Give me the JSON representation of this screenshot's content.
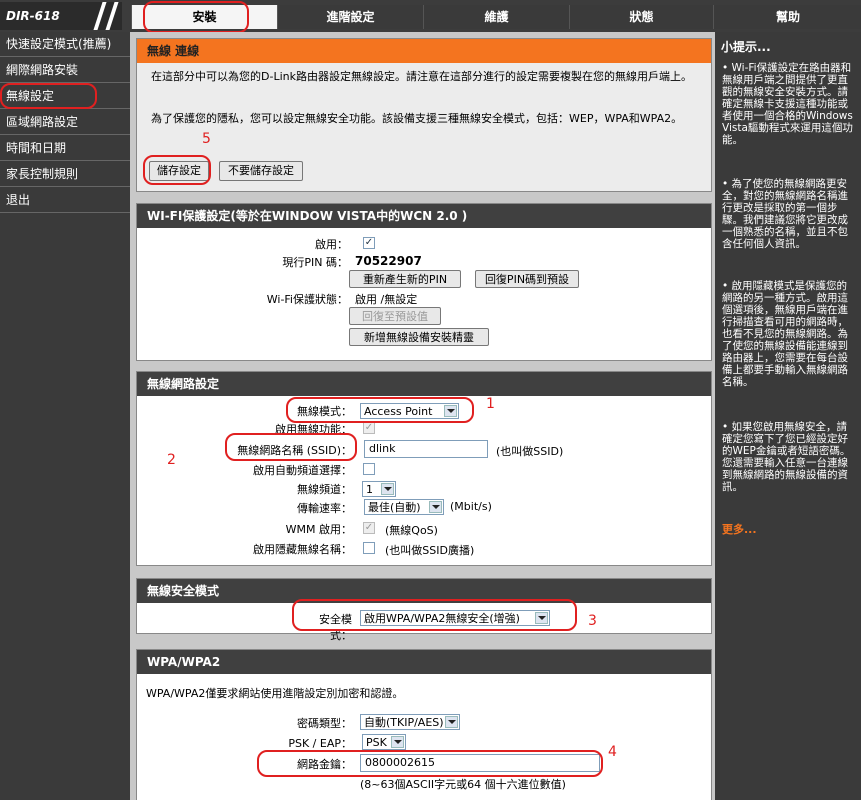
{
  "brand": {
    "model": "DIR-618"
  },
  "nav_tabs": [
    "安裝",
    "進階設定",
    "維護",
    "狀態",
    "幫助"
  ],
  "left_menu": [
    "快速設定模式(推薦)",
    "網際網路安裝",
    "無線設定",
    "區域網路設定",
    "時間和日期",
    "家長控制規則",
    "退出"
  ],
  "wireless_intro": {
    "title": "無線 連線",
    "p1": "在這部分中可以為您的D-Link路由器設定無線設定。請注意在這部分進行的設定需要複製在您的無線用戶端上。",
    "p2": "為了保護您的隱私，您可以設定無線安全功能。該設備支援三種無線安全模式，包括：WEP，WPA和WPA2。",
    "save_label": "儲存設定",
    "nosave_label": "不要儲存設定"
  },
  "wps": {
    "title": "WI-FI保護設定(等於在WINDOW VISTA中的WCN 2.0 )",
    "enable_label": "啟用：",
    "pin_label": "現行PIN 碼：",
    "pin_value": "70522907",
    "regen_label": "重新產生新的PIN",
    "reset_pin_label": "回復PIN碼到預設",
    "status_label": "Wi-Fi保護狀態：",
    "status_value": "啟用 /無設定",
    "restore_label": "回復至預設值",
    "wizard_label": "新增無線設備安裝精靈"
  },
  "network": {
    "title": "無線網路設定",
    "mode_label": "無線模式：",
    "mode_value": "Access Point",
    "enable_label": "啟用無線功能：",
    "ssid_label": "無線網路名稱 (SSID)：",
    "ssid_value": "dlink",
    "ssid_note": "(也叫做SSID)",
    "autochan_label": "啟用自動頻道選擇：",
    "channel_label": "無線頻道：",
    "channel_value": "1",
    "rate_label": "傳輸速率：",
    "rate_value": "最佳(自動)",
    "rate_unit": "(Mbit/s)",
    "wmm_label": "WMM 啟用：",
    "wmm_note": "(無線QoS)",
    "hidden_label": "啟用隱藏無線名稱：",
    "hidden_note": "(也叫做SSID廣播)"
  },
  "security": {
    "title": "無線安全模式",
    "mode_label": "安全模式：",
    "mode_value": "啟用WPA/WPA2無線安全(增強)"
  },
  "wpa": {
    "title": "WPA/WPA2",
    "desc": "WPA/WPA2僅要求網站使用進階設定別加密和認證。",
    "cipher_label": "密碼類型：",
    "cipher_value": "自動(TKIP/AES)",
    "psk_label": "PSK / EAP：",
    "psk_value": "PSK",
    "key_label": "網路金鑰：",
    "key_value": "0800002615",
    "key_note": "(8~63個ASCII字元或64 個十六進位數值)"
  },
  "annotations": [
    "1",
    "2",
    "3",
    "4",
    "5"
  ],
  "help": {
    "title": "小提示...",
    "tips": [
      "• Wi-Fi保護設定在路由器和無線用戶端之間提供了更直觀的無線安全安裝方式。請確定無線卡支援這種功能或者使用一個合格的Windows Vista驅動程式來運用這個功能。",
      "• 為了使您的無線網路更安全，對您的無線網路名稱進行更改是採取的第一個步驟。我們建議您將它更改成一個熟悉的名稱，並且不包含任何個人資訊。",
      "• 啟用隱藏模式是保護您的網路的另一種方式。啟用這個選項後，無線用戶端在進行掃描查看可用的網路時，也看不見您的無線網路。為了使您的無線設備能連線到路由器上，您需要在每台設備上都要手動輸入無線網路名稱。",
      "• 如果您啟用無線安全，請確定您寫下了您已經設定好的WEP金鑰或者短語密碼。您還需要輸入任意一台連線到無線網路的無線設備的資訊。"
    ],
    "more": "更多..."
  },
  "colors": {
    "accent": "#f4741f",
    "annotation": "#e02020",
    "dark": "#3a3a3a"
  }
}
